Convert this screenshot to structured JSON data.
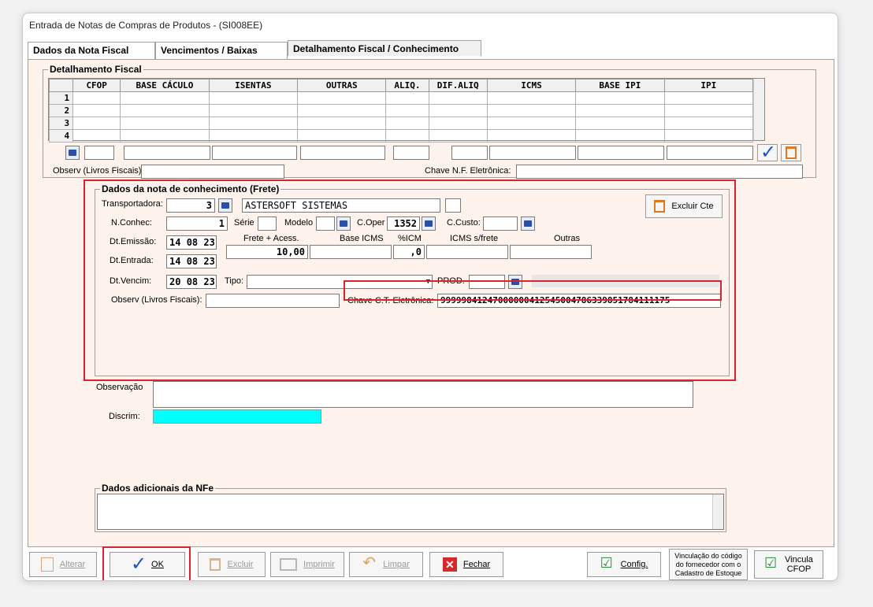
{
  "window": {
    "title": "Entrada de Notas de Compras de Produtos - (SI008EE)"
  },
  "tabs": [
    {
      "label": "Dados da Nota Fiscal"
    },
    {
      "label": "Vencimentos / Baixas"
    },
    {
      "label": "Detalhamento Fiscal / Conhecimento"
    }
  ],
  "fiscal": {
    "legend": "Detalhamento Fiscal",
    "columns": [
      "CFOP",
      "BASE CÁCULO",
      "ISENTAS",
      "OUTRAS",
      "ALIQ.",
      "DIF.ALIQ",
      "ICMS",
      "BASE IPI",
      "IPI"
    ],
    "rows": [
      "1",
      "2",
      "3",
      "4"
    ],
    "observ_label": "Observ (Livros Fiscais):",
    "chave_label": "Chave N.F. Eletrônica:"
  },
  "frete": {
    "legend": "Dados da nota de conhecimento (Frete)",
    "transportadora_label": "Transportadora:",
    "transportadora_code": "3",
    "transportadora_name": "ASTERSOFT SISTEMAS",
    "excluir_cte_label": "Excluir Cte",
    "nconhec_label": "N.Conhec:",
    "nconhec_value": "1",
    "serie_label": "Série",
    "modelo_label": "Modelo",
    "coper_label": "C.Oper",
    "coper_value": "1352",
    "ccusto_label": "C.Custo:",
    "dt_emissao_label": "Dt.Emissão:",
    "dt_emissao": [
      "14",
      "08",
      "23"
    ],
    "dt_entrada_label": "Dt.Entrada:",
    "dt_entrada": [
      "14",
      "08",
      "23"
    ],
    "dt_vencim_label": "Dt.Vencim:",
    "dt_vencim": [
      "20",
      "08",
      "23"
    ],
    "frete_label": "Frete + Acess.",
    "frete_value": "10,00",
    "base_icms_label": "Base ICMS",
    "icm_label": "%ICM",
    "icm_value": ",0",
    "icms_frete_label": "ICMS s/frete",
    "outras_label": "Outras",
    "tipo_label": "Tipo:",
    "prod_label": "PROD.",
    "observ_label": "Observ (Livros Fiscais):",
    "chave_ct_label": "Chave C.T. Eletrônica:",
    "chave_ct_value": "99999841247000000412545004786339851784111175"
  },
  "observacao_label": "Observação",
  "discrim_label": "Discrim:",
  "adicionais_legend": "Dados adicionais da NFe",
  "buttons": {
    "alterar": "Alterar",
    "ok": "OK",
    "excluir": "Excluir",
    "imprimir": "Imprimir",
    "limpar": "Limpar",
    "fechar": "Fechar",
    "config": "Config.",
    "vinculacao_line1": "Vinculação do código",
    "vinculacao_line2": "do fornecedor com o",
    "vinculacao_line3": "Cadastro de Estoque",
    "vincula_line1": "Vincula",
    "vincula_line2": "CFOP"
  }
}
